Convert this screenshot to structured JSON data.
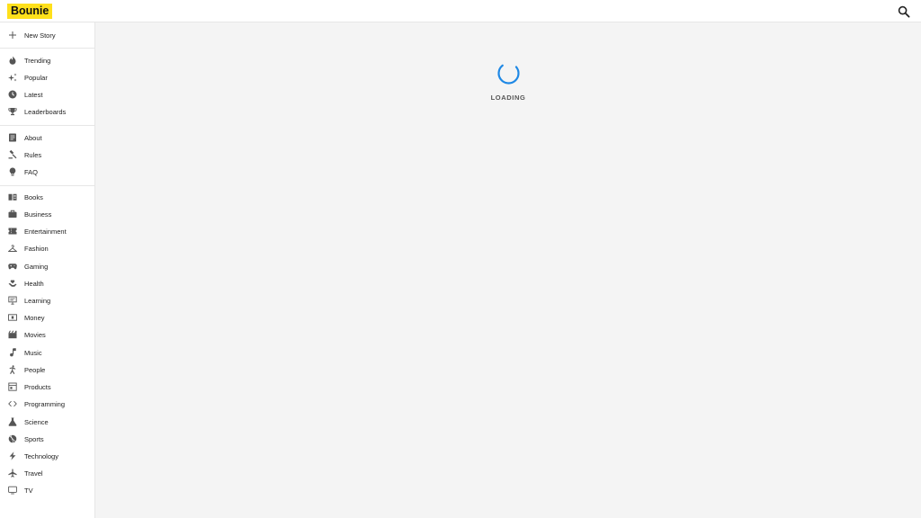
{
  "header": {
    "logo": "Bounie",
    "search_icon": "search-icon"
  },
  "sidebar": {
    "new_story": "New Story",
    "primary": [
      "Trending",
      "Popular",
      "Latest",
      "Leaderboards"
    ],
    "info": [
      "About",
      "Rules",
      "FAQ"
    ],
    "categories": [
      "Books",
      "Business",
      "Entertainment",
      "Fashion",
      "Gaming",
      "Health",
      "Learning",
      "Money",
      "Movies",
      "Music",
      "People",
      "Products",
      "Programming",
      "Science",
      "Sports",
      "Technology",
      "Travel",
      "TV"
    ]
  },
  "main": {
    "loading_text": "LOADING"
  },
  "colors": {
    "brand": "#ffe01b",
    "spinner": "#1e88e5",
    "background": "#f4f4f4"
  }
}
